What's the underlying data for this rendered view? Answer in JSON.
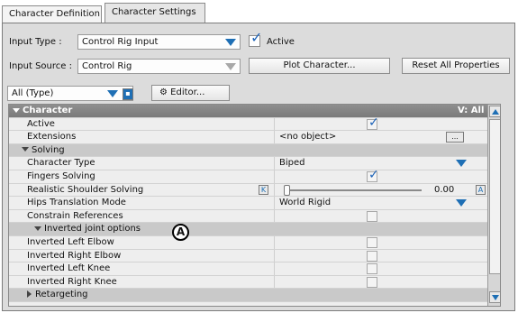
{
  "tabs": [
    "Character Definition",
    "Character Settings"
  ],
  "inputs": {
    "input_type_label": "Input Type :",
    "input_type_value": "Control Rig Input",
    "active_label": "Active",
    "input_source_label": "Input Source :",
    "input_source_value": "Control Rig",
    "plot_button": "Plot Character...",
    "reset_button": "Reset All Properties"
  },
  "toolbar": {
    "filter_value": "All (Type)",
    "editor_button": "Editor..."
  },
  "properties": {
    "header": "Character",
    "header_right": "V: All",
    "rows": [
      {
        "name": "Active",
        "kind": "check",
        "checked": true
      },
      {
        "name": "Extensions",
        "kind": "text",
        "value": "<no object>",
        "button": "..."
      },
      {
        "name": "Solving",
        "kind": "section"
      },
      {
        "name": "Character Type",
        "kind": "enum",
        "value": "Biped"
      },
      {
        "name": "Fingers Solving",
        "kind": "check",
        "checked": true
      },
      {
        "name": "Realistic Shoulder Solving",
        "kind": "slider",
        "value": "0.00",
        "key_left": "K",
        "key_right": "A"
      },
      {
        "name": "Hips Translation Mode",
        "kind": "enum",
        "value": "World Rigid"
      },
      {
        "name": "Constrain References",
        "kind": "check",
        "checked": false
      },
      {
        "name": "Inverted joint options",
        "kind": "subsection"
      },
      {
        "name": "Inverted Left Elbow",
        "kind": "check",
        "checked": false
      },
      {
        "name": "Inverted Right Elbow",
        "kind": "check",
        "checked": false
      },
      {
        "name": "Inverted Left Knee",
        "kind": "check",
        "checked": false
      },
      {
        "name": "Inverted Right Knee",
        "kind": "check",
        "checked": false
      },
      {
        "name": "Retargeting",
        "kind": "collapsed"
      }
    ]
  },
  "callout": "A",
  "colors": {
    "accent": "#1e6fb5",
    "panel": "#dcdcdc",
    "header": "#8a8a8a"
  }
}
